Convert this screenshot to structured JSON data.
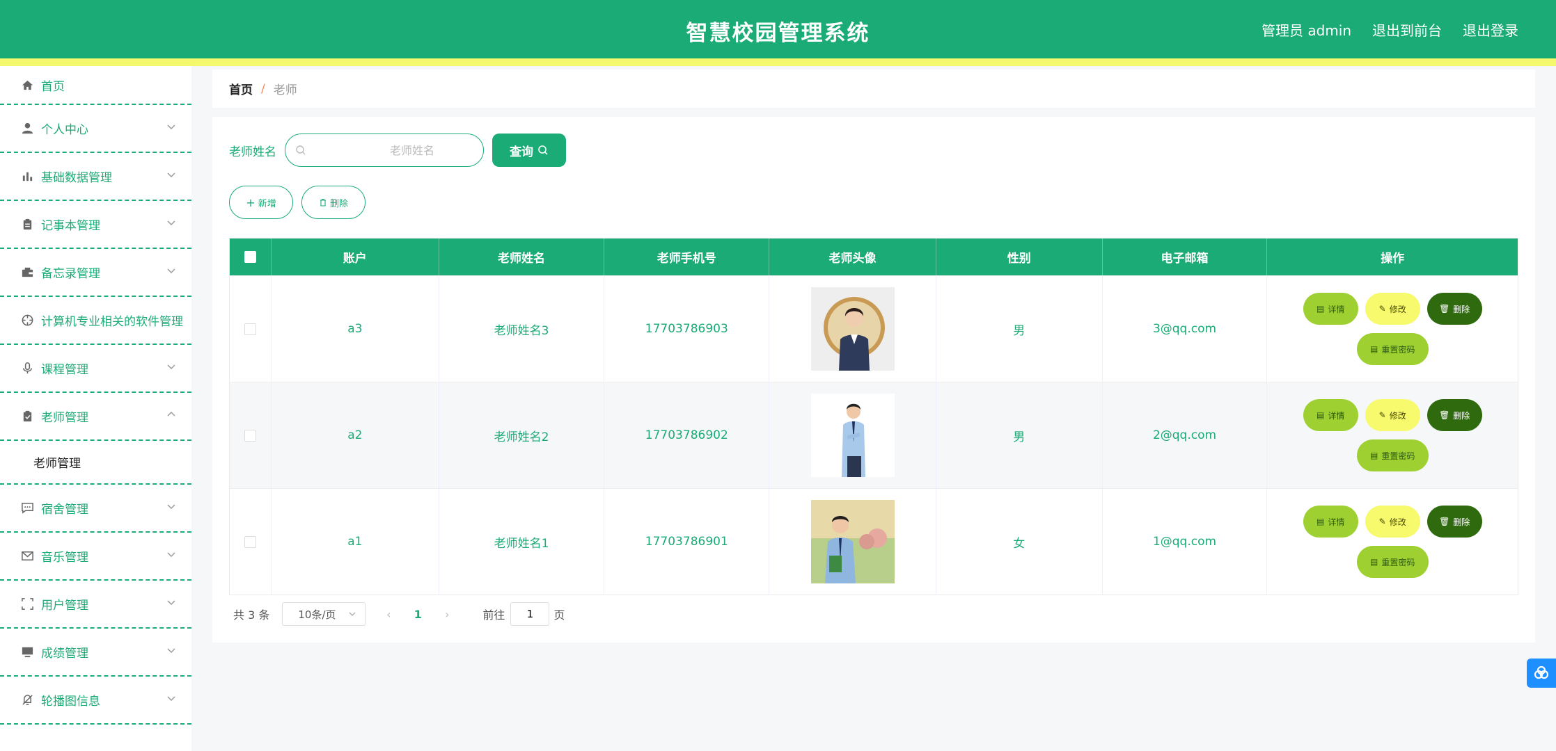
{
  "header": {
    "title": "智慧校园管理系统",
    "admin_label": "管理员 admin",
    "exit_front_label": "退出到前台",
    "logout_label": "退出登录",
    "color": "#1aab76",
    "stripe_color": "#f3f86c"
  },
  "sidebar": {
    "items": [
      {
        "label": "首页",
        "icon": "home-icon"
      },
      {
        "label": "个人中心",
        "icon": "user-icon"
      },
      {
        "label": "基础数据管理",
        "icon": "bar-chart-icon"
      },
      {
        "label": "记事本管理",
        "icon": "clipboard-icon"
      },
      {
        "label": "备忘录管理",
        "icon": "wallet-icon"
      },
      {
        "label": "计算机专业相关的软件管理",
        "icon": "crosshair-icon"
      },
      {
        "label": "课程管理",
        "icon": "microphone-icon"
      },
      {
        "label": "老师管理",
        "icon": "clipboard-check-icon"
      },
      {
        "label": "宿舍管理",
        "icon": "chat-icon"
      },
      {
        "label": "音乐管理",
        "icon": "mail-icon"
      },
      {
        "label": "用户管理",
        "icon": "fullscreen-icon"
      },
      {
        "label": "成绩管理",
        "icon": "monitor-icon"
      },
      {
        "label": "轮播图信息",
        "icon": "bell-off-icon"
      }
    ],
    "submenu_label": "老师管理"
  },
  "breadcrumb": {
    "home": "首页",
    "separator": "/",
    "current": "老师"
  },
  "search": {
    "label": "老师姓名",
    "placeholder": "老师姓名",
    "query_label": "查询"
  },
  "actions": {
    "add_label": "新增",
    "delete_label": "删除"
  },
  "table": {
    "columns": [
      "账户",
      "老师姓名",
      "老师手机号",
      "老师头像",
      "性别",
      "电子邮箱",
      "操作"
    ],
    "rows": [
      {
        "account": "a3",
        "name": "老师姓名3",
        "phone": "17703786903",
        "gender": "男",
        "email": "3@qq.com"
      },
      {
        "account": "a2",
        "name": "老师姓名2",
        "phone": "17703786902",
        "gender": "男",
        "email": "2@qq.com"
      },
      {
        "account": "a1",
        "name": "老师姓名1",
        "phone": "17703786901",
        "gender": "女",
        "email": "1@qq.com"
      }
    ],
    "op_labels": {
      "detail": "详情",
      "edit": "修改",
      "delete": "删除",
      "reset": "重置密码"
    }
  },
  "pagination": {
    "total": "共 3 条",
    "page_size": "10条/页",
    "current_page": "1",
    "goto_label": "前往",
    "goto_value": "1",
    "page_suffix": "页"
  }
}
